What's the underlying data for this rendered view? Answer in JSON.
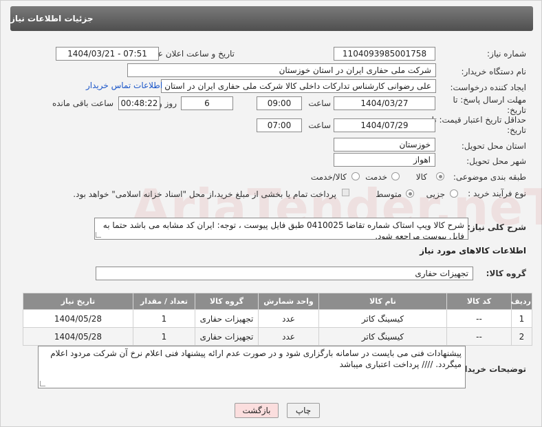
{
  "header": {
    "title": "جزئیات اطلاعات نیاز"
  },
  "form": {
    "need_number_label": "شماره نیاز:",
    "need_number": "1104093985001758",
    "announce_label": "تاریخ و ساعت اعلان عمومی:",
    "announce_value": "1404/03/21 - 07:51",
    "buyer_org_label": "نام دستگاه خریدار:",
    "buyer_org": "شرکت ملی حفاری ایران در استان خوزستان",
    "creator_label": "ایجاد کننده درخواست:",
    "creator": "علی رضوانی کارشناس تدارکات داخلی  کالا شرکت ملی حفاری ایران در استان خوزستان",
    "contact_link": "اطلاعات تماس خریدار",
    "deadline_label": "مهلت ارسال پاسخ: تا تاریخ:",
    "deadline_date": "1404/03/27",
    "time_label": "ساعت",
    "deadline_time": "09:00",
    "days_value": "6",
    "days_label": "روز و",
    "remaining_time": "00:48:22",
    "remaining_label": "ساعت باقی مانده",
    "validity_label": "حداقل تاریخ اعتبار قیمت: تا تاریخ:",
    "validity_date": "1404/07/29",
    "validity_time": "07:00",
    "province_label": "استان محل تحویل:",
    "province": "خوزستان",
    "city_label": "شهر محل تحویل:",
    "city": "اهواز",
    "category_label": "طبقه بندی موضوعی:",
    "category_options": [
      "کالا",
      "خدمت",
      "کالا/خدمت"
    ],
    "process_label": "نوع فرآیند خرید :",
    "process_options": [
      "جزیی",
      "متوسط"
    ],
    "payment_note": "پرداخت تمام یا بخشی از مبلغ خرید،از محل \"اسناد خزانه اسلامی\" خواهد بود."
  },
  "description": {
    "label": "شرح کلی نیاز:",
    "text": "شرح کالا ویپ استاک شماره تقاضا 0410025 طبق فایل پیوست ، توجه: ایران کد مشابه می باشد حتما به فایل پیوست مراجعه شود."
  },
  "goods": {
    "section_title": "اطلاعات کالاهای مورد نیاز",
    "group_label": "گروه کالا:",
    "group_value": "تجهیزات حفاری",
    "columns": [
      "ردیف",
      "کد کالا",
      "نام کالا",
      "واحد شمارش",
      "گروه کالا",
      "تعداد / مقدار",
      "تاریخ نیاز"
    ],
    "rows": [
      [
        "1",
        "--",
        "کیسینگ کاتر",
        "عدد",
        "تجهیزات حفاری",
        "1",
        "1404/05/28"
      ],
      [
        "2",
        "--",
        "کیسینگ کاتر",
        "عدد",
        "تجهیزات حفاری",
        "1",
        "1404/05/28"
      ]
    ]
  },
  "buyer_notes": {
    "label": "توضیحات خریدار:",
    "text": "پیشنهادات فنی می بایست در سامانه بارگزاری شود و در صورت عدم ارائه پیشنهاد فنی اعلام نرخ آن شرکت مردود اعلام میگردد.  //// پرداخت اعتباری میباشد"
  },
  "buttons": {
    "print": "چاپ",
    "back": "بازگشت"
  },
  "watermark": {
    "text": "AriaTender.neT"
  }
}
